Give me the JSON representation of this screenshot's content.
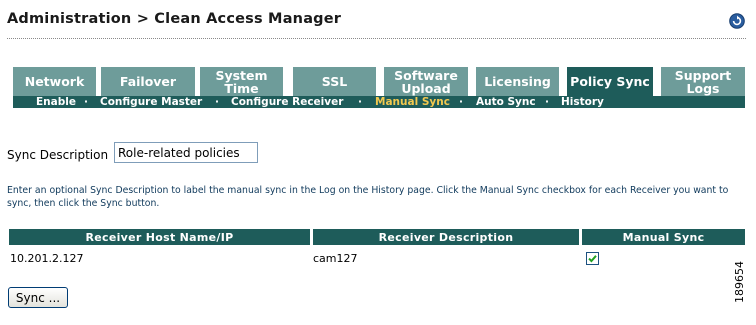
{
  "header": {
    "title": "Administration > Clean Access Manager",
    "help_icon": "refresh-help-icon"
  },
  "tabs": [
    {
      "label": "Network",
      "active": false
    },
    {
      "label": "Failover",
      "active": false
    },
    {
      "label": "System Time",
      "active": false
    },
    {
      "label": "SSL",
      "active": false
    },
    {
      "label": "Software Upload",
      "active": false
    },
    {
      "label": "Licensing",
      "active": false
    },
    {
      "label": "Policy Sync",
      "active": true
    },
    {
      "label": "Support Logs",
      "active": false
    }
  ],
  "subnav": {
    "items": [
      {
        "label": "Enable",
        "active": false
      },
      {
        "label": "Configure Master",
        "active": false
      },
      {
        "label": "Configure Receiver",
        "active": false
      },
      {
        "label": "Manual Sync",
        "active": true
      },
      {
        "label": "Auto Sync",
        "active": false
      },
      {
        "label": "History",
        "active": false
      }
    ],
    "separator": "·"
  },
  "form": {
    "sync_description_label": "Sync Description",
    "sync_description_value": "Role-related policies"
  },
  "instructions": "Enter an optional Sync Description to label the manual sync in the Log on the History page. Click the Manual Sync checkbox for each Receiver you want to sync, then click the Sync button.",
  "table": {
    "headers": [
      "Receiver Host Name/IP",
      "Receiver Description",
      "Manual Sync"
    ],
    "rows": [
      {
        "host": "10.201.2.127",
        "description": "cam127",
        "manual_sync": true
      }
    ]
  },
  "sync_button_label": "Sync ...",
  "figure_id": "189654",
  "colors": {
    "tab": "#6e9c9a",
    "tab_active": "#1e5c5a",
    "subnav_active_text": "#f3c94f",
    "instructions_text": "#103a5c"
  }
}
